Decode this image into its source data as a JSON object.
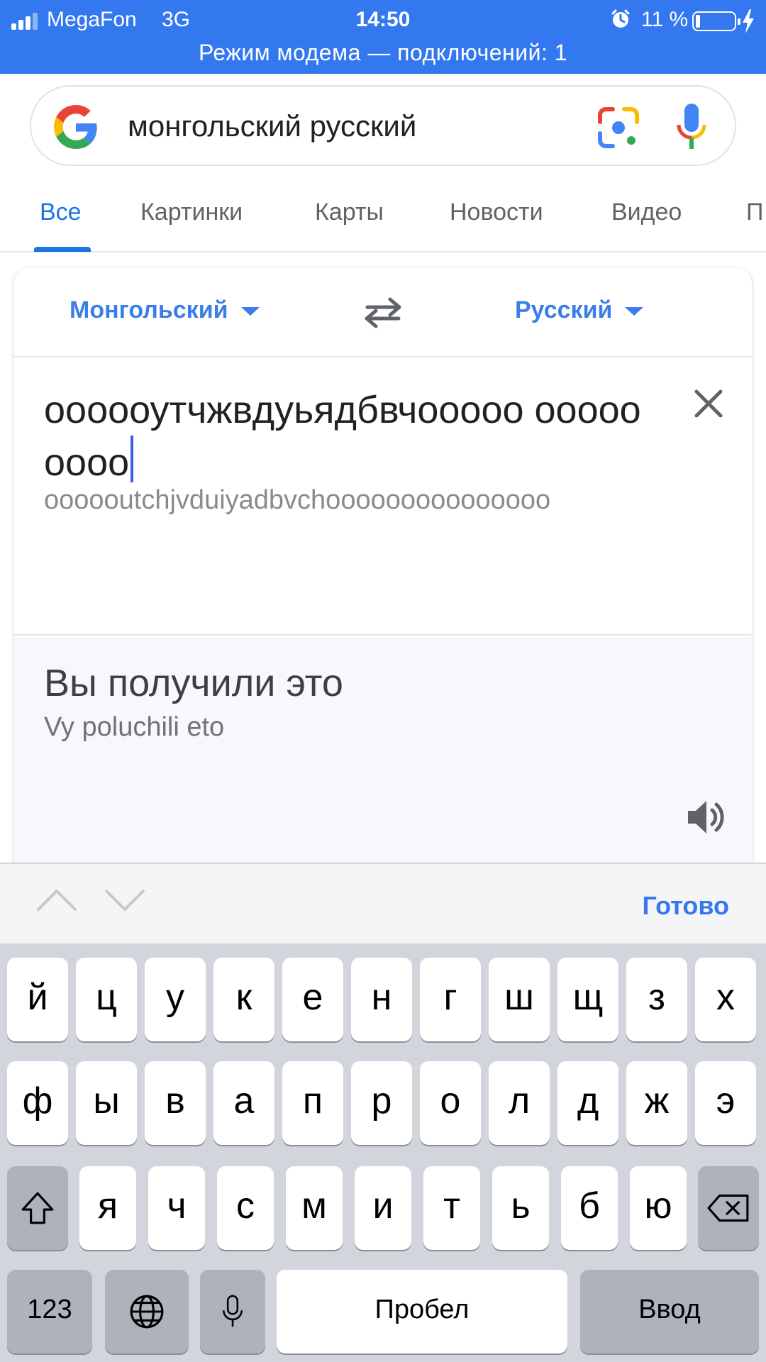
{
  "status_bar": {
    "carrier": "MegaFon",
    "network": "3G",
    "time": "14:50",
    "battery_percent": "11 %",
    "battery_level": 0.11,
    "hotspot_text": "Режим модема — подключений: 1"
  },
  "search": {
    "query": "монгольский русский"
  },
  "tabs": [
    {
      "label": "Все"
    },
    {
      "label": "Картинки"
    },
    {
      "label": "Карты"
    },
    {
      "label": "Новости"
    },
    {
      "label": "Видео"
    },
    {
      "label": "П"
    }
  ],
  "translator": {
    "source_lang": "Монгольский",
    "target_lang": "Русский",
    "source_text": "оооооутчжвдуьядбвчооооо ооооооооо",
    "source_transliteration": "oooooutchjvduiyadbvchooooooooooooooo",
    "translation": "Вы получили это",
    "translation_transliteration": "Vy poluchili eto"
  },
  "accessory": {
    "done_label": "Готово"
  },
  "keyboard": {
    "row1": [
      "й",
      "ц",
      "у",
      "к",
      "е",
      "н",
      "г",
      "ш",
      "щ",
      "з",
      "х"
    ],
    "row2": [
      "ф",
      "ы",
      "в",
      "а",
      "п",
      "р",
      "о",
      "л",
      "д",
      "ж",
      "э"
    ],
    "row3": [
      "я",
      "ч",
      "с",
      "м",
      "и",
      "т",
      "ь",
      "б",
      "ю"
    ],
    "numbers_label": "123",
    "space_label": "Пробел",
    "return_label": "Ввод"
  },
  "colors": {
    "status_bar": "#3478f0",
    "accent": "#1a73e8",
    "language_link": "#3b7ee8"
  }
}
